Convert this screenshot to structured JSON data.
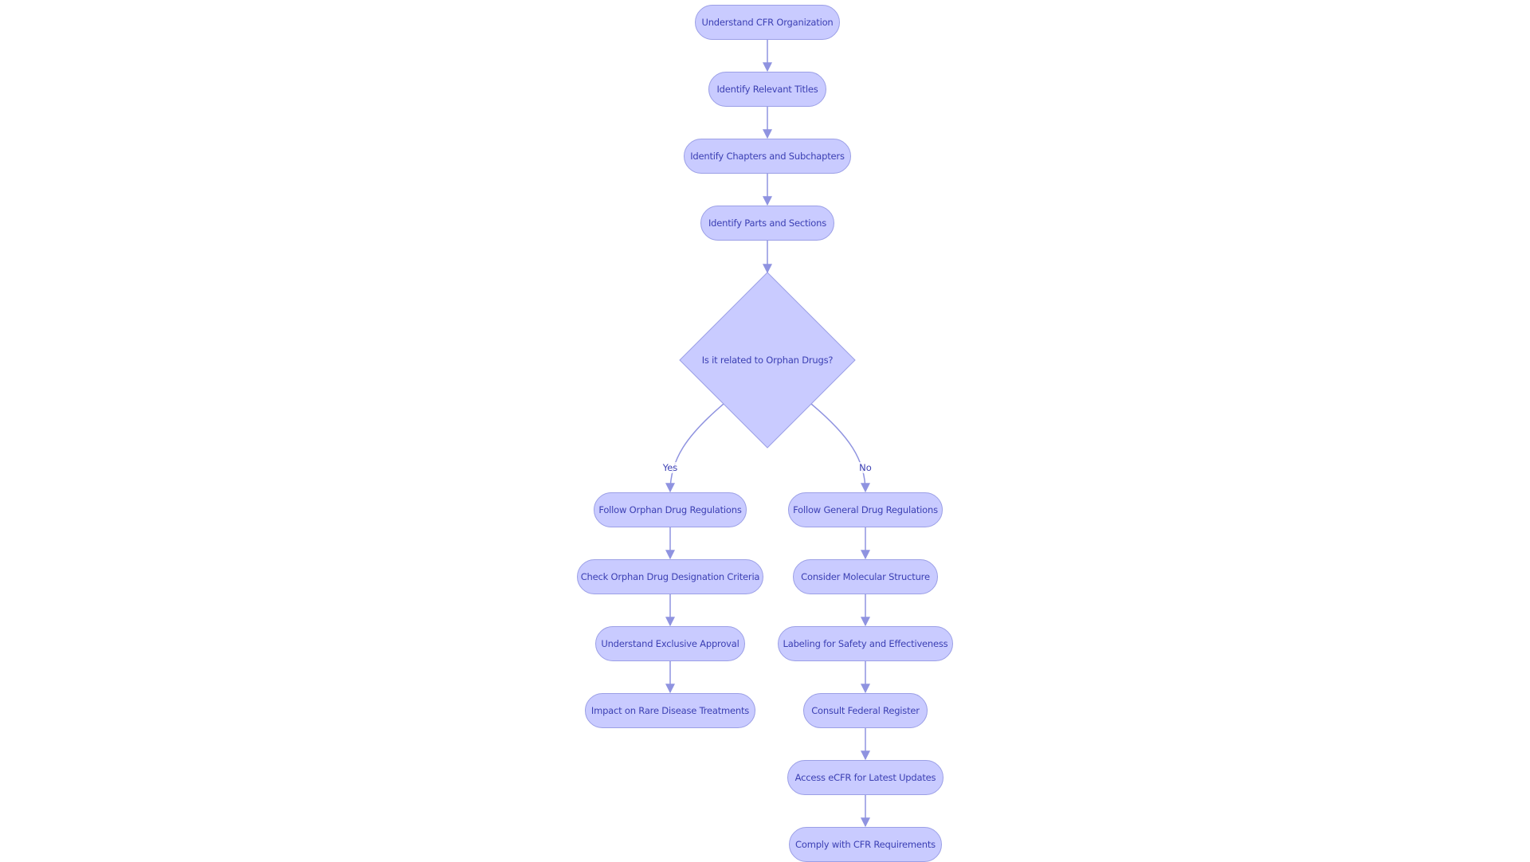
{
  "diagram": {
    "type": "flowchart",
    "colors": {
      "node_fill": "#c9cbff",
      "node_border": "#9b9fe6",
      "text": "#3b3fb3",
      "edge": "#8f93e0"
    },
    "nodes": [
      {
        "id": "n1",
        "label": "Understand CFR Organization",
        "shape": "rounded"
      },
      {
        "id": "n2",
        "label": "Identify Relevant Titles",
        "shape": "rounded"
      },
      {
        "id": "n3",
        "label": "Identify Chapters and Subchapters",
        "shape": "rounded"
      },
      {
        "id": "n4",
        "label": "Identify Parts and Sections",
        "shape": "rounded"
      },
      {
        "id": "d1",
        "label": "Is it related to Orphan Drugs?",
        "shape": "diamond"
      },
      {
        "id": "y1",
        "label": "Follow Orphan Drug Regulations",
        "shape": "rounded"
      },
      {
        "id": "y2",
        "label": "Check Orphan Drug Designation Criteria",
        "shape": "rounded"
      },
      {
        "id": "y3",
        "label": "Understand Exclusive Approval",
        "shape": "rounded"
      },
      {
        "id": "y4",
        "label": "Impact on Rare Disease Treatments",
        "shape": "rounded"
      },
      {
        "id": "m1",
        "label": "Follow General Drug Regulations",
        "shape": "rounded"
      },
      {
        "id": "m2",
        "label": "Consider Molecular Structure",
        "shape": "rounded"
      },
      {
        "id": "m3",
        "label": "Labeling for Safety and Effectiveness",
        "shape": "rounded"
      },
      {
        "id": "m4",
        "label": "Consult Federal Register",
        "shape": "rounded"
      },
      {
        "id": "m5",
        "label": "Access eCFR for Latest Updates",
        "shape": "rounded"
      },
      {
        "id": "m6",
        "label": "Comply with CFR Requirements",
        "shape": "rounded"
      }
    ],
    "edges": [
      {
        "from": "n1",
        "to": "n2",
        "label": ""
      },
      {
        "from": "n2",
        "to": "n3",
        "label": ""
      },
      {
        "from": "n3",
        "to": "n4",
        "label": ""
      },
      {
        "from": "n4",
        "to": "d1",
        "label": ""
      },
      {
        "from": "d1",
        "to": "y1",
        "label": "Yes"
      },
      {
        "from": "d1",
        "to": "m1",
        "label": "No"
      },
      {
        "from": "y1",
        "to": "y2",
        "label": ""
      },
      {
        "from": "y2",
        "to": "y3",
        "label": ""
      },
      {
        "from": "y3",
        "to": "y4",
        "label": ""
      },
      {
        "from": "m1",
        "to": "m2",
        "label": ""
      },
      {
        "from": "m2",
        "to": "m3",
        "label": ""
      },
      {
        "from": "m3",
        "to": "m4",
        "label": ""
      },
      {
        "from": "m4",
        "to": "m5",
        "label": ""
      },
      {
        "from": "m5",
        "to": "m6",
        "label": ""
      }
    ]
  }
}
